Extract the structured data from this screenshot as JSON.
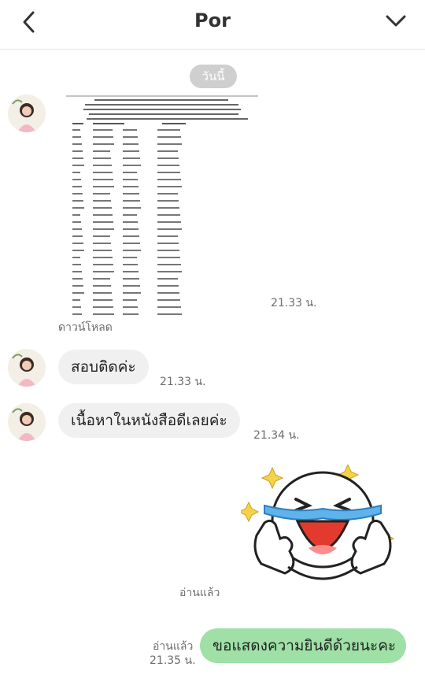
{
  "header": {
    "title": "Por"
  },
  "date_divider": "วันนี้",
  "messages": [
    {
      "type": "image",
      "time": "21.33 น.",
      "download_label": "ดาวน์โหลด"
    },
    {
      "type": "text",
      "text": "สอบติดค่ะ",
      "time": "21.33 น."
    },
    {
      "type": "text",
      "text": "เนื้อหาในหนังสือดีเลยค่ะ",
      "time": "21.34 น."
    },
    {
      "type": "sticker",
      "read_label": "อ่านแล้ว"
    },
    {
      "type": "text_out",
      "text": "ขอแสดงความยินดีด้วยนะคะ",
      "read_label": "อ่านแล้ว",
      "time": "21.35 น."
    }
  ],
  "colors": {
    "outgoing_bubble": "#9ee0a6",
    "incoming_bubble": "#f0f0f0",
    "date_pill": "#cfcfcf"
  }
}
